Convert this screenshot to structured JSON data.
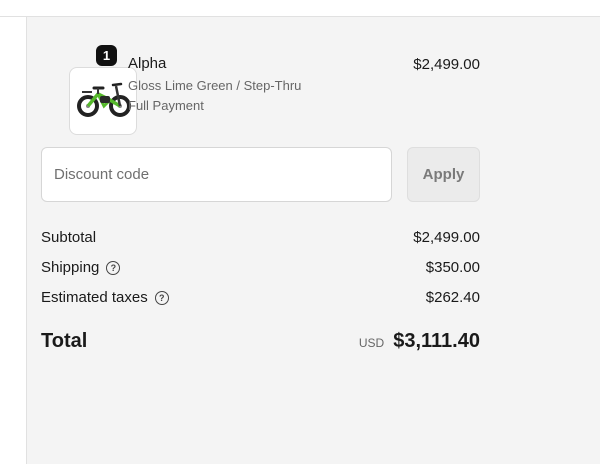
{
  "product": {
    "name": "Alpha",
    "variant": "Gloss Lime Green / Step-Thru",
    "payment": "Full Payment",
    "price": "$2,499.00",
    "quantity": "1",
    "image_icon": "ebike-image"
  },
  "discount": {
    "placeholder": "Discount code",
    "value": "",
    "apply_label": "Apply"
  },
  "summary": {
    "subtotal_label": "Subtotal",
    "subtotal_value": "$2,499.00",
    "shipping_label": "Shipping",
    "shipping_value": "$350.00",
    "taxes_label": "Estimated taxes",
    "taxes_value": "$262.40",
    "help_icon": "?",
    "total_label": "Total",
    "currency": "USD",
    "total_value": "$3,111.40"
  },
  "colors": {
    "panel_bg": "#f4f4f4",
    "badge_bg": "#111111",
    "bike_accent": "#55b82b"
  }
}
